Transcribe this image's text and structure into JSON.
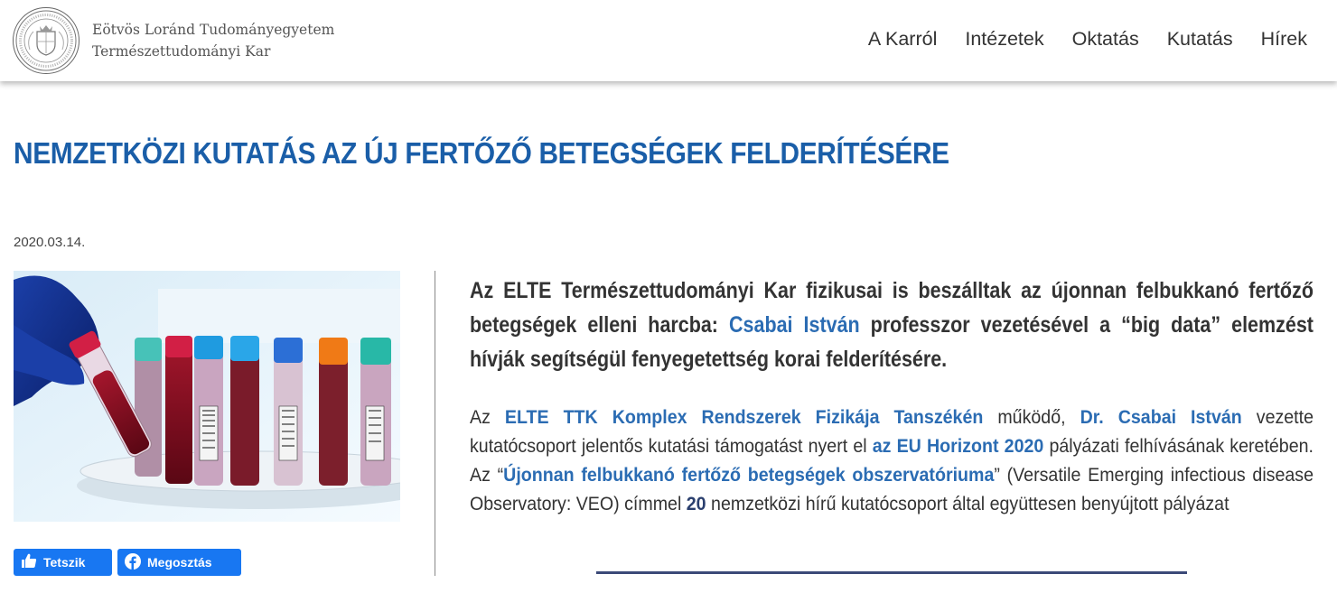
{
  "header": {
    "university": "Eötvös Loránd Tudományegyetem",
    "faculty": "Természettudományi Kar",
    "nav": [
      "A Karról",
      "Intézetek",
      "Oktatás",
      "Kutatás",
      "Hírek"
    ]
  },
  "article": {
    "title": "NEMZETKÖZI KUTATÁS AZ ÚJ FERTŐZŐ BETEGSÉGEK FELDERÍTÉSÉRE",
    "date": "2020.03.14.",
    "lead": {
      "part1": "Az ELTE Természettudományi Kar fizikusai is beszálltak az újonnan felbukkanó fertőző betegségek elleni harcba: ",
      "link": "Csabai István",
      "part2": " professzor vezetésével a “big data” elemzést hívják segítségül fenyegetettség korai felderítésére."
    },
    "body": {
      "t1": "Az ",
      "link1": "ELTE TTK Komplex Rendszerek Fizikája Tanszékén",
      "t2": " működő, ",
      "link2": "Dr. Csabai István",
      "t3": " vezette kutatócsoport jelentős kutatási támogatást nyert el ",
      "link3": "az EU Horizont 2020",
      "t4": " pályázati felhívásának keretében. Az “",
      "link4": "Újonnan felbukkanó fertőző betegségek obszervatóriuma",
      "t5": "” (Versatile Emerging infectious disease Observatory: VEO) címmel ",
      "num": "20",
      "t6": " nemzetközi hírű kutatócsoport által együttesen benyújtott pályázat"
    }
  },
  "social": {
    "like": "Tetszik",
    "share": "Megosztás"
  },
  "colors": {
    "title": "#1a5ea8",
    "link": "#2b6cb3",
    "facebook": "#1877f2",
    "rule": "#3b4a78"
  },
  "icons": [
    "university-seal-logo",
    "thumbs-up-icon",
    "facebook-icon"
  ]
}
